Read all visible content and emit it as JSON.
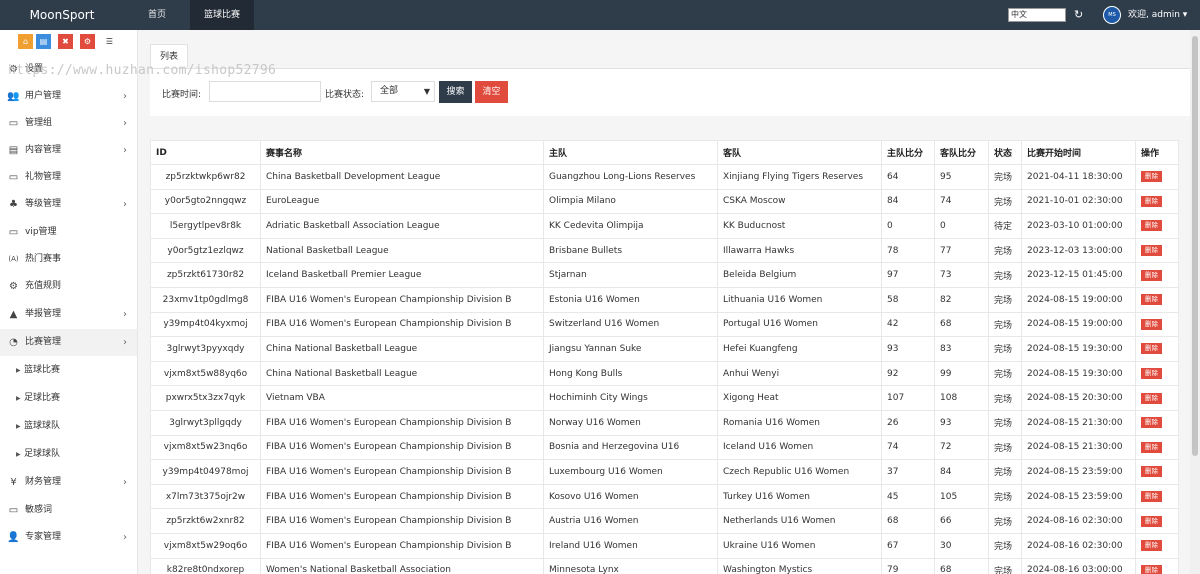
{
  "header": {
    "logo": "MoonSport",
    "nav": [
      {
        "label": "首页"
      },
      {
        "label": "篮球比赛"
      }
    ],
    "language": "中文",
    "welcome": "欢迎, admin ▾",
    "avatar_text": "MS"
  },
  "sidebar": {
    "quick_icons": [
      {
        "icon": "home-icon",
        "color": "#f0a030"
      },
      {
        "icon": "file-icon",
        "color": "#3c8dde"
      },
      {
        "icon": "trash-icon",
        "color": "#e04b3d"
      },
      {
        "icon": "gear-icon",
        "color": "#e04b3d"
      },
      {
        "icon": "list-icon",
        "color": "#ffffff"
      }
    ],
    "watermark": "https://www.huzhan.com/ishop52796",
    "items": [
      {
        "label": "设置",
        "icon": "⚙"
      },
      {
        "label": "用户管理",
        "icon": "👥",
        "chevron": "›"
      },
      {
        "label": "管理组",
        "icon": "▭",
        "chevron": "›"
      },
      {
        "label": "内容管理",
        "icon": "▤",
        "chevron": "›"
      },
      {
        "label": "礼物管理",
        "icon": "▭"
      },
      {
        "label": "等级管理",
        "icon": "♣",
        "chevron": "›"
      },
      {
        "label": "vip管理",
        "icon": "▭"
      },
      {
        "label": "热门赛事",
        "icon": "(A)"
      },
      {
        "label": "充值规则",
        "icon": "⚙"
      },
      {
        "label": "举报管理",
        "icon": "▲",
        "chevron": "›"
      },
      {
        "label": "比赛管理",
        "icon": "◔",
        "chevron": "›"
      }
    ],
    "sub_items": [
      {
        "label": "篮球比赛"
      },
      {
        "label": "足球比赛"
      },
      {
        "label": "篮球球队"
      },
      {
        "label": "足球球队"
      }
    ],
    "bottom_items": [
      {
        "label": "财务管理",
        "icon": "¥",
        "chevron": "›"
      },
      {
        "label": "敏感词",
        "icon": "▭"
      },
      {
        "label": "专家管理",
        "icon": "👤",
        "chevron": "›"
      }
    ]
  },
  "content": {
    "tab": "列表",
    "filter": {
      "time_label": "比赛时间:",
      "time_value": "",
      "status_label": "比赛状态:",
      "status_value": "全部",
      "search_button": "搜索",
      "clear_button": "清空"
    },
    "table": {
      "headers": [
        "ID",
        "赛事名称",
        "主队",
        "客队",
        "主队比分",
        "客队比分",
        "状态",
        "比赛开始时间",
        "操作"
      ],
      "delete_label": "删除",
      "rows": [
        [
          "zp5rzktwkp6wr82",
          "China Basketball Development League",
          "Guangzhou Long-Lions Reserves",
          "Xinjiang Flying Tigers Reserves",
          "64",
          "95",
          "完场",
          "2021-04-11 18:30:00"
        ],
        [
          "y0or5gto2nngqwz",
          "EuroLeague",
          "Olimpia Milano",
          "CSKA Moscow",
          "84",
          "74",
          "完场",
          "2021-10-01 02:30:00"
        ],
        [
          "l5ergytlpev8r8k",
          "Adriatic Basketball Association League",
          "KK Cedevita Olimpija",
          "KK Buducnost",
          "0",
          "0",
          "待定",
          "2023-03-10 01:00:00"
        ],
        [
          "y0or5gtz1ezlqwz",
          "National Basketball League",
          "Brisbane Bullets",
          "Illawarra Hawks",
          "78",
          "77",
          "完场",
          "2023-12-03 13:00:00"
        ],
        [
          "zp5rzkt61730r82",
          "Iceland Basketball Premier League",
          "Stjarnan",
          "Beleida Belgium",
          "97",
          "73",
          "完场",
          "2023-12-15 01:45:00"
        ],
        [
          "23xmv1tp0gdlmg8",
          "FIBA U16 Women's European Championship Division B",
          "Estonia U16 Women",
          "Lithuania U16 Women",
          "58",
          "82",
          "完场",
          "2024-08-15 19:00:00"
        ],
        [
          "y39mp4t04kyxmoj",
          "FIBA U16 Women's European Championship Division B",
          "Switzerland U16 Women",
          "Portugal U16 Women",
          "42",
          "68",
          "完场",
          "2024-08-15 19:00:00"
        ],
        [
          "3glrwyt3pyyxqdy",
          "China National Basketball League",
          "Jiangsu Yannan Suke",
          "Hefei Kuangfeng",
          "93",
          "83",
          "完场",
          "2024-08-15 19:30:00"
        ],
        [
          "vjxm8xt5w88yq6o",
          "China National Basketball League",
          "Hong Kong Bulls",
          "Anhui Wenyi",
          "92",
          "99",
          "完场",
          "2024-08-15 19:30:00"
        ],
        [
          "pxwrx5tx3zx7qyk",
          "Vietnam VBA",
          "Hochiminh City Wings",
          "Xigong Heat",
          "107",
          "108",
          "完场",
          "2024-08-15 20:30:00"
        ],
        [
          "3glrwyt3pllgqdy",
          "FIBA U16 Women's European Championship Division B",
          "Norway U16 Women",
          "Romania U16 Women",
          "26",
          "93",
          "完场",
          "2024-08-15 21:30:00"
        ],
        [
          "vjxm8xt5w23nq6o",
          "FIBA U16 Women's European Championship Division B",
          "Bosnia and Herzegovina U16",
          "Iceland U16 Women",
          "74",
          "72",
          "完场",
          "2024-08-15 21:30:00"
        ],
        [
          "y39mp4t04978moj",
          "FIBA U16 Women's European Championship Division B",
          "Luxembourg U16 Women",
          "Czech Republic U16 Women",
          "37",
          "84",
          "完场",
          "2024-08-15 23:59:00"
        ],
        [
          "x7lm73t375ojr2w",
          "FIBA U16 Women's European Championship Division B",
          "Kosovo U16 Women",
          "Turkey U16 Women",
          "45",
          "105",
          "完场",
          "2024-08-15 23:59:00"
        ],
        [
          "zp5rzkt6w2xnr82",
          "FIBA U16 Women's European Championship Division B",
          "Austria U16 Women",
          "Netherlands U16 Women",
          "68",
          "66",
          "完场",
          "2024-08-16 02:30:00"
        ],
        [
          "vjxm8xt5w29oq6o",
          "FIBA U16 Women's European Championship Division B",
          "Ireland U16 Women",
          "Ukraine U16 Women",
          "67",
          "30",
          "完场",
          "2024-08-16 02:30:00"
        ],
        [
          "k82re8t0ndxorep",
          "Women's National Basketball Association",
          "Minnesota Lynx",
          "Washington Mystics",
          "79",
          "68",
          "完场",
          "2024-08-16 03:00:00"
        ]
      ]
    }
  }
}
